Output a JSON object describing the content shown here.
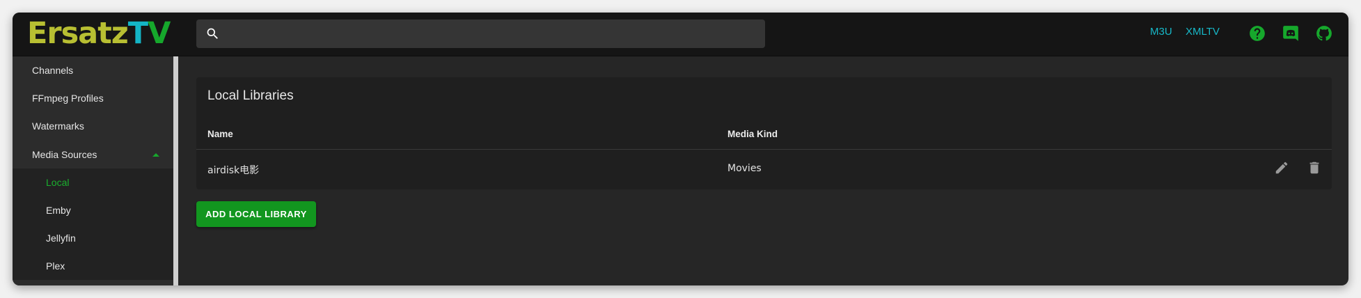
{
  "app": {
    "logo_part1": "Ersatz",
    "logo_part2": "T",
    "logo_part3": "V",
    "colors": {
      "accent_green": "#16a82c",
      "accent_cyan": "#17b8c8",
      "logo_yellow": "#b8bf32"
    }
  },
  "header": {
    "search": {
      "placeholder": "",
      "value": "",
      "icon": "search-icon"
    },
    "links": [
      "M3U",
      "XMLTV"
    ],
    "icons": [
      "help-icon",
      "discord-icon",
      "github-icon"
    ]
  },
  "sidebar": {
    "items": [
      {
        "label": "Channels"
      },
      {
        "label": "FFmpeg Profiles"
      },
      {
        "label": "Watermarks"
      },
      {
        "label": "Media Sources",
        "expanded": true,
        "icon": "chevron-up-icon"
      },
      {
        "label": "Local",
        "active": true
      },
      {
        "label": "Emby"
      },
      {
        "label": "Jellyfin"
      },
      {
        "label": "Plex"
      }
    ]
  },
  "main": {
    "title": "Local Libraries",
    "columns": [
      "Name",
      "Media Kind"
    ],
    "rows": [
      {
        "name": "airdisk电影",
        "media_kind": "Movies",
        "actions": [
          "edit-icon",
          "delete-icon"
        ]
      }
    ],
    "add_button": "ADD LOCAL LIBRARY"
  }
}
